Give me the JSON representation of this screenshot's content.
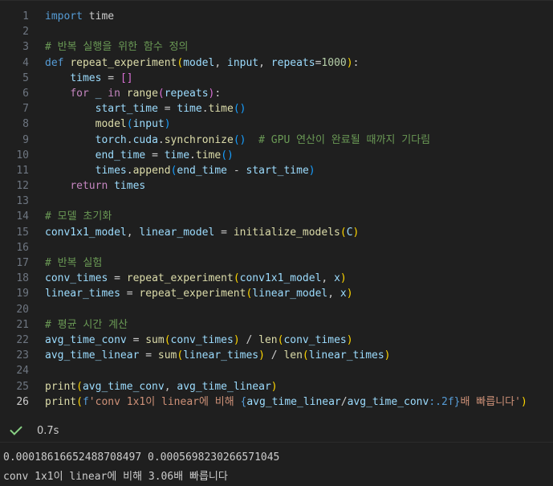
{
  "editor": {
    "lines": [
      {
        "n": "1",
        "tokens": [
          [
            "kw",
            "import"
          ],
          [
            "plain",
            " time"
          ]
        ]
      },
      {
        "n": "2",
        "tokens": []
      },
      {
        "n": "3",
        "tokens": [
          [
            "cmt",
            "# 반복 실행을 위한 함수 정의"
          ]
        ]
      },
      {
        "n": "4",
        "tokens": [
          [
            "kw",
            "def"
          ],
          [
            "plain",
            " "
          ],
          [
            "fn",
            "repeat_experiment"
          ],
          [
            "p1",
            "("
          ],
          [
            "var",
            "model"
          ],
          [
            "plain",
            ", "
          ],
          [
            "var",
            "input"
          ],
          [
            "plain",
            ", "
          ],
          [
            "var",
            "repeats"
          ],
          [
            "plain",
            "="
          ],
          [
            "num",
            "1000"
          ],
          [
            "p1",
            ")"
          ],
          [
            "plain",
            ":"
          ]
        ]
      },
      {
        "n": "5",
        "tokens": [
          [
            "plain",
            "    "
          ],
          [
            "var",
            "times"
          ],
          [
            "plain",
            " = "
          ],
          [
            "p2",
            "[]"
          ]
        ]
      },
      {
        "n": "6",
        "tokens": [
          [
            "plain",
            "    "
          ],
          [
            "ctl",
            "for"
          ],
          [
            "plain",
            " "
          ],
          [
            "var",
            "_"
          ],
          [
            "plain",
            " "
          ],
          [
            "ctl",
            "in"
          ],
          [
            "plain",
            " "
          ],
          [
            "fn",
            "range"
          ],
          [
            "p2",
            "("
          ],
          [
            "var",
            "repeats"
          ],
          [
            "p2",
            ")"
          ],
          [
            "plain",
            ":"
          ]
        ]
      },
      {
        "n": "7",
        "tokens": [
          [
            "plain",
            "        "
          ],
          [
            "var",
            "start_time"
          ],
          [
            "plain",
            " = "
          ],
          [
            "var",
            "time"
          ],
          [
            "plain",
            "."
          ],
          [
            "fn",
            "time"
          ],
          [
            "p3",
            "()"
          ]
        ]
      },
      {
        "n": "8",
        "tokens": [
          [
            "plain",
            "        "
          ],
          [
            "fn",
            "model"
          ],
          [
            "p3",
            "("
          ],
          [
            "var",
            "input"
          ],
          [
            "p3",
            ")"
          ]
        ]
      },
      {
        "n": "9",
        "tokens": [
          [
            "plain",
            "        "
          ],
          [
            "var",
            "torch"
          ],
          [
            "plain",
            "."
          ],
          [
            "var",
            "cuda"
          ],
          [
            "plain",
            "."
          ],
          [
            "fn",
            "synchronize"
          ],
          [
            "p3",
            "()"
          ],
          [
            "plain",
            "  "
          ],
          [
            "cmt",
            "# GPU 연산이 완료될 때까지 기다림"
          ]
        ]
      },
      {
        "n": "10",
        "tokens": [
          [
            "plain",
            "        "
          ],
          [
            "var",
            "end_time"
          ],
          [
            "plain",
            " = "
          ],
          [
            "var",
            "time"
          ],
          [
            "plain",
            "."
          ],
          [
            "fn",
            "time"
          ],
          [
            "p3",
            "()"
          ]
        ]
      },
      {
        "n": "11",
        "tokens": [
          [
            "plain",
            "        "
          ],
          [
            "var",
            "times"
          ],
          [
            "plain",
            "."
          ],
          [
            "fn",
            "append"
          ],
          [
            "p3",
            "("
          ],
          [
            "var",
            "end_time"
          ],
          [
            "plain",
            " - "
          ],
          [
            "var",
            "start_time"
          ],
          [
            "p3",
            ")"
          ]
        ]
      },
      {
        "n": "12",
        "tokens": [
          [
            "plain",
            "    "
          ],
          [
            "ctl",
            "return"
          ],
          [
            "plain",
            " "
          ],
          [
            "var",
            "times"
          ]
        ]
      },
      {
        "n": "13",
        "tokens": []
      },
      {
        "n": "14",
        "tokens": [
          [
            "cmt",
            "# 모델 초기화"
          ]
        ]
      },
      {
        "n": "15",
        "tokens": [
          [
            "var",
            "conv1x1_model"
          ],
          [
            "plain",
            ", "
          ],
          [
            "var",
            "linear_model"
          ],
          [
            "plain",
            " = "
          ],
          [
            "fn",
            "initialize_models"
          ],
          [
            "p1",
            "("
          ],
          [
            "var",
            "C"
          ],
          [
            "p1",
            ")"
          ]
        ]
      },
      {
        "n": "16",
        "tokens": []
      },
      {
        "n": "17",
        "tokens": [
          [
            "cmt",
            "# 반복 실험"
          ]
        ]
      },
      {
        "n": "18",
        "tokens": [
          [
            "var",
            "conv_times"
          ],
          [
            "plain",
            " = "
          ],
          [
            "fn",
            "repeat_experiment"
          ],
          [
            "p1",
            "("
          ],
          [
            "var",
            "conv1x1_model"
          ],
          [
            "plain",
            ", "
          ],
          [
            "var",
            "x"
          ],
          [
            "p1",
            ")"
          ]
        ]
      },
      {
        "n": "19",
        "tokens": [
          [
            "var",
            "linear_times"
          ],
          [
            "plain",
            " = "
          ],
          [
            "fn",
            "repeat_experiment"
          ],
          [
            "p1",
            "("
          ],
          [
            "var",
            "linear_model"
          ],
          [
            "plain",
            ", "
          ],
          [
            "var",
            "x"
          ],
          [
            "p1",
            ")"
          ]
        ]
      },
      {
        "n": "20",
        "tokens": []
      },
      {
        "n": "21",
        "tokens": [
          [
            "cmt",
            "# 평균 시간 계산"
          ]
        ]
      },
      {
        "n": "22",
        "tokens": [
          [
            "var",
            "avg_time_conv"
          ],
          [
            "plain",
            " = "
          ],
          [
            "fn",
            "sum"
          ],
          [
            "p1",
            "("
          ],
          [
            "var",
            "conv_times"
          ],
          [
            "p1",
            ")"
          ],
          [
            "plain",
            " / "
          ],
          [
            "fn",
            "len"
          ],
          [
            "p1",
            "("
          ],
          [
            "var",
            "conv_times"
          ],
          [
            "p1",
            ")"
          ]
        ]
      },
      {
        "n": "23",
        "tokens": [
          [
            "var",
            "avg_time_linear"
          ],
          [
            "plain",
            " = "
          ],
          [
            "fn",
            "sum"
          ],
          [
            "p1",
            "("
          ],
          [
            "var",
            "linear_times"
          ],
          [
            "p1",
            ")"
          ],
          [
            "plain",
            " / "
          ],
          [
            "fn",
            "len"
          ],
          [
            "p1",
            "("
          ],
          [
            "var",
            "linear_times"
          ],
          [
            "p1",
            ")"
          ]
        ]
      },
      {
        "n": "24",
        "tokens": []
      },
      {
        "n": "25",
        "tokens": [
          [
            "fn",
            "print"
          ],
          [
            "p1",
            "("
          ],
          [
            "var",
            "avg_time_conv"
          ],
          [
            "plain",
            ", "
          ],
          [
            "var",
            "avg_time_linear"
          ],
          [
            "p1",
            ")"
          ]
        ]
      },
      {
        "n": "26",
        "tokens": [
          [
            "fn",
            "print"
          ],
          [
            "p1",
            "("
          ],
          [
            "kw",
            "f"
          ],
          [
            "str",
            "'conv 1x1이 linear에 비해 "
          ],
          [
            "kw",
            "{"
          ],
          [
            "var",
            "avg_time_linear"
          ],
          [
            "plain",
            "/"
          ],
          [
            "var",
            "avg_time_conv"
          ],
          [
            "kw",
            ":.2f}"
          ],
          [
            "str",
            "배 빠릅니다'"
          ],
          [
            "p1",
            ")"
          ]
        ]
      }
    ]
  },
  "status": {
    "icon": "check-icon",
    "duration": "0.7s",
    "color": "#89d185"
  },
  "output": {
    "line1": "0.00018616652488708497 0.0005698230266571045",
    "line2": "conv 1x1이 linear에 비해 3.06배 빠릅니다"
  }
}
